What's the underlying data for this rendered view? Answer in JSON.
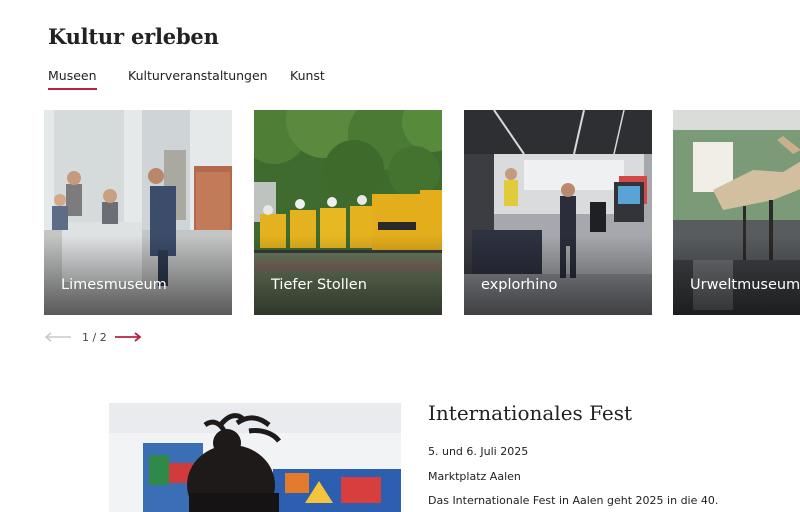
{
  "section": {
    "title": "Kultur erleben"
  },
  "tabs": [
    {
      "label": "Museen",
      "active": true
    },
    {
      "label": "Kulturveranstaltungen",
      "active": false
    },
    {
      "label": "Kunst",
      "active": false
    }
  ],
  "cards": [
    {
      "label": "Limesmuseum"
    },
    {
      "label": "Tiefer Stollen"
    },
    {
      "label": "explorhino"
    },
    {
      "label": "Urweltmuseum"
    }
  ],
  "pager": {
    "text": "1 / 2",
    "prev_icon": "arrow-left-icon",
    "next_icon": "arrow-right-icon"
  },
  "event": {
    "title": "Internationales Fest",
    "date": "5. und 6. Juli 2025",
    "place": "Marktplatz Aalen",
    "description": "Das Internationale Fest in Aalen geht 2025 in die 40."
  },
  "colors": {
    "accent": "#b3243f",
    "text": "#1f1f1f"
  }
}
